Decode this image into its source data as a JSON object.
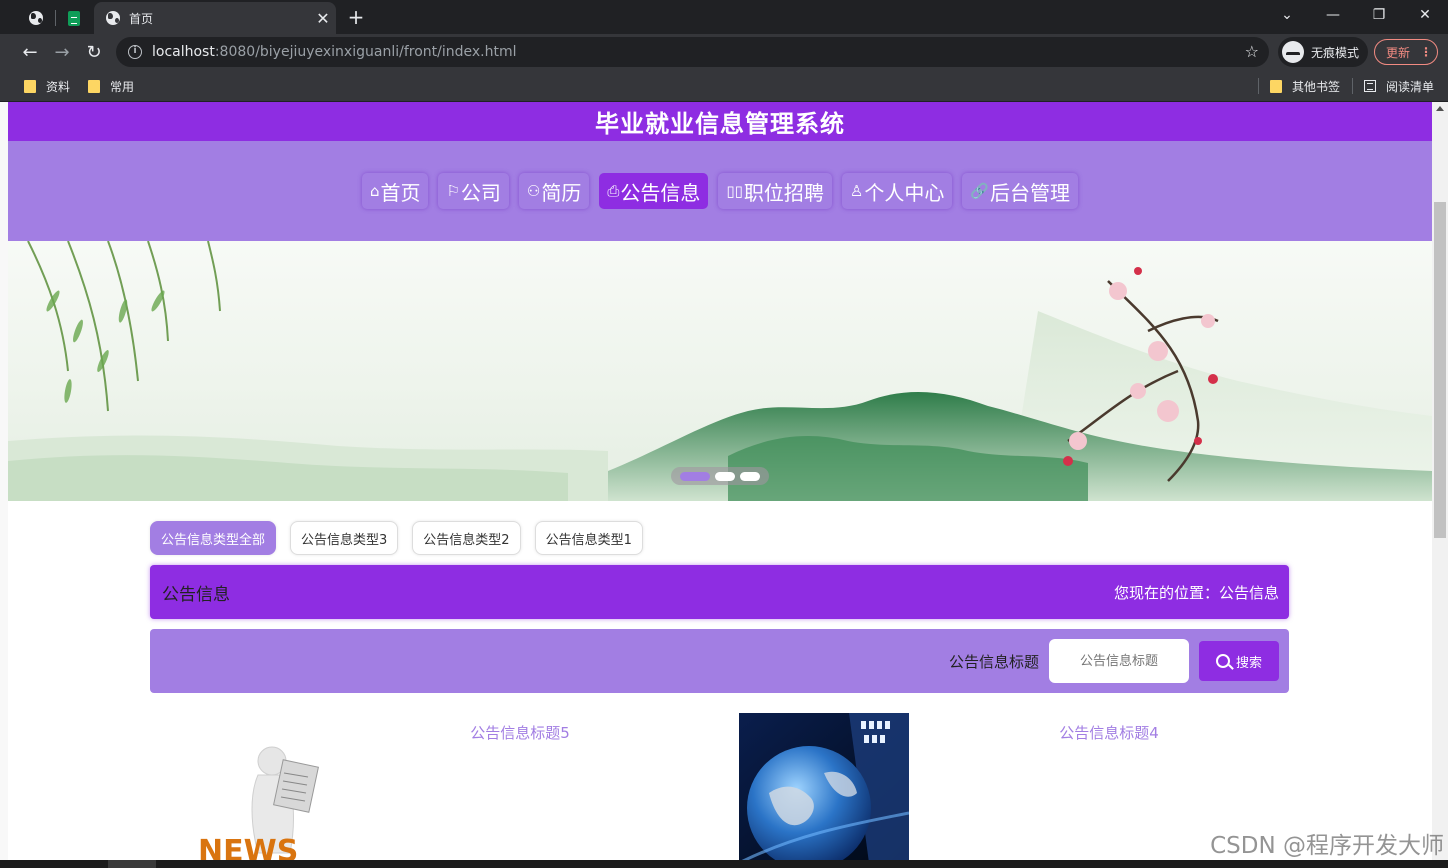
{
  "browser": {
    "tab_title": "首页",
    "url_host": "localhost",
    "url_rest": ":8080/biyejiuyexinxiguanli/front/index.html",
    "incognito_label": "无痕模式",
    "update_label": "更新",
    "bookmarks": [
      "资料",
      "常用"
    ],
    "other_bookmarks": "其他书签",
    "reading_list": "阅读清单"
  },
  "site": {
    "title": "毕业就业信息管理系统",
    "nav": [
      {
        "icon": "⌂",
        "label": "首页"
      },
      {
        "icon": "⚐",
        "label": "公司"
      },
      {
        "icon": "⚇",
        "label": "简历"
      },
      {
        "icon": "⎙",
        "label": "公告信息"
      },
      {
        "icon": "▯▯",
        "label": "职位招聘"
      },
      {
        "icon": "♙",
        "label": "个人中心"
      },
      {
        "icon": "🔗",
        "label": "后台管理"
      }
    ],
    "active_nav": 3
  },
  "filters": [
    "公告信息类型全部",
    "公告信息类型3",
    "公告信息类型2",
    "公告信息类型1"
  ],
  "location": {
    "title": "公告信息",
    "path": "您现在的位置：公告信息"
  },
  "search": {
    "label": "公告信息标题",
    "placeholder": "公告信息标题",
    "button": "搜索"
  },
  "notices": [
    {
      "title": "公告信息标题5"
    },
    {
      "title": "公告信息标题4"
    }
  ],
  "watermark": "CSDN @程序开发大师",
  "colors": {
    "primary": "#8e2de2",
    "secondary": "#a27ee3"
  }
}
